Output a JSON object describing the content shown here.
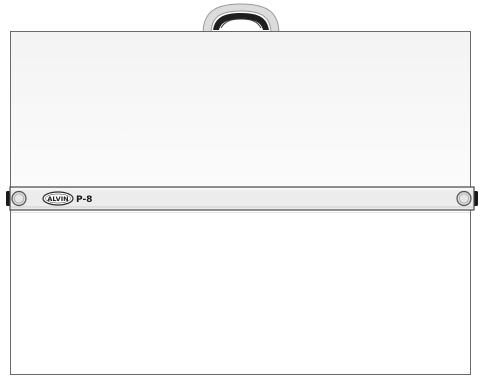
{
  "product": {
    "brand_logo": "ALVIN",
    "model_label": "P-8"
  },
  "colors": {
    "board_border": "#6a6a6a",
    "board_fill": "#ffffff",
    "ruler_fill": "#e9e9e9",
    "handle_grip": "#1f1f1f",
    "handle_frame": "#c9c9c9"
  },
  "icons": {
    "handle": "carry-handle-icon",
    "left_knob": "ruler-end-knob-icon",
    "right_knob": "ruler-end-knob-icon",
    "logo": "alvin-logo-icon"
  }
}
